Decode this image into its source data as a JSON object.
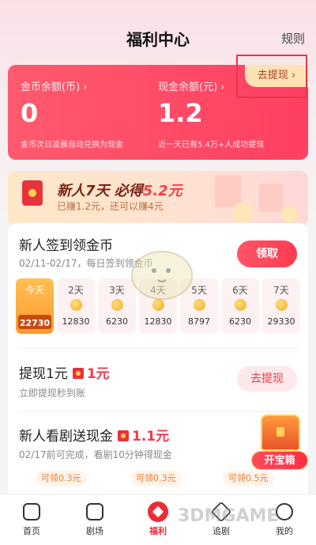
{
  "header": {
    "title": "福利中心",
    "rules": "规则"
  },
  "balance": {
    "coin_label": "金币余额(币) ›",
    "coin_value": "0",
    "coin_note": "金币次日凌晨自动兑换为现金",
    "cash_label": "现金余额(元) ›",
    "cash_value": "1.2",
    "cash_note": "近一天已有5.4万+人成功提现",
    "withdraw": "去提现 ›"
  },
  "newbie": {
    "headline_a": "新人7天 必得",
    "headline_amount": "5.2元",
    "subline": "已赚1.2元，还可以赚4元"
  },
  "signin": {
    "title": "新人签到领金币",
    "subtitle": "02/11-02/17，每日签到领金币",
    "button": "领取",
    "days": [
      {
        "label": "今天",
        "value": "22730"
      },
      {
        "label": "2天",
        "value": "12830"
      },
      {
        "label": "3天",
        "value": "6230"
      },
      {
        "label": "4天",
        "value": "12830"
      },
      {
        "label": "5天",
        "value": "8797"
      },
      {
        "label": "6天",
        "value": "6230"
      },
      {
        "label": "7天",
        "value": "29330"
      }
    ]
  },
  "withdraw_task": {
    "title": "提现1元",
    "amount": "1元",
    "subtitle": "立即提现秒到账",
    "button": "去提现"
  },
  "drama_task": {
    "title": "新人看剧送现金",
    "amount": "1.1元",
    "subtitle": "02/17前可完成，看剧10分钟得现金",
    "chips": [
      "可领0.3元",
      "可领0.3元",
      "可领0.5元"
    ]
  },
  "treasure": {
    "label": "开宝箱"
  },
  "tabs": [
    {
      "label": "首页",
      "icon": "home-icon"
    },
    {
      "label": "剧场",
      "icon": "play-icon"
    },
    {
      "label": "福利",
      "icon": "gift-icon"
    },
    {
      "label": "追剧",
      "icon": "star-icon"
    },
    {
      "label": "我的",
      "icon": "user-icon"
    }
  ],
  "watermark": "3DMGAME"
}
